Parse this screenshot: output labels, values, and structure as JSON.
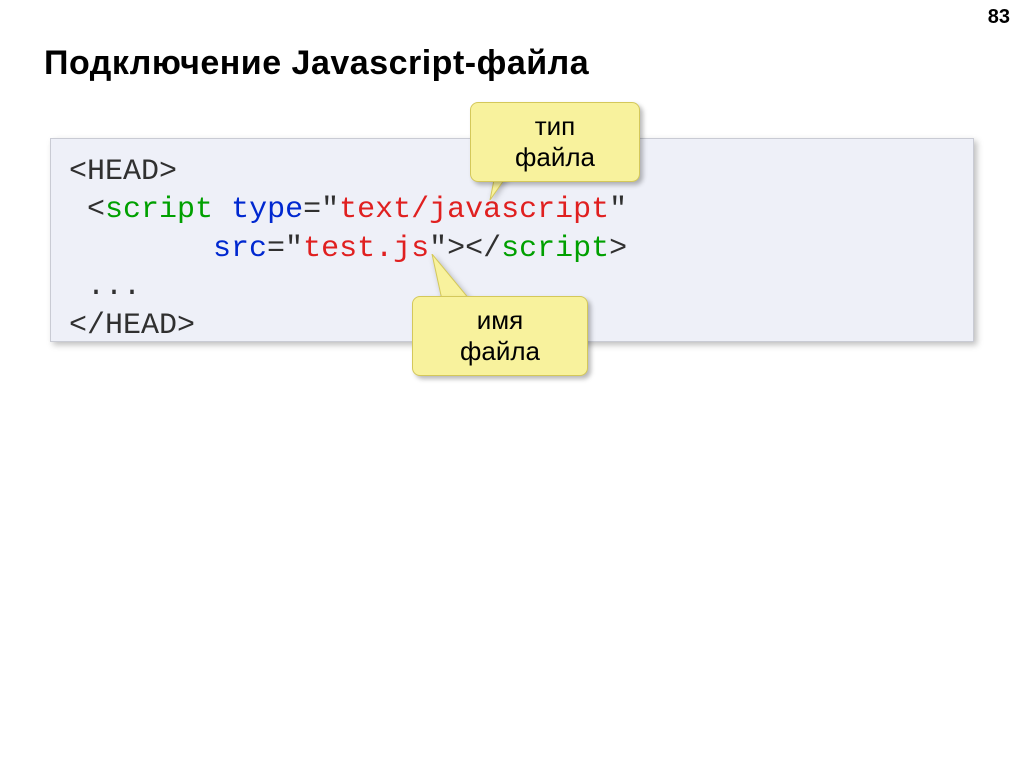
{
  "page_number": "83",
  "title": "Подключение Javascript-файла",
  "callouts": {
    "file_type": "тип файла",
    "file_name": "имя файла"
  },
  "code": {
    "line1_open": "<HEAD>",
    "line2_indent": " <",
    "line2_tag": "script",
    "line2_sp": " ",
    "line2_attr1": "type",
    "line2_eqq": "=\"",
    "line2_val1": "text/javascript",
    "line2_q": "\"",
    "line3_indent": "        ",
    "line3_attr2": "src",
    "line3_eqq": "=\"",
    "line3_val2": "test.js",
    "line3_qgt": "\">",
    "line3_clo": "</",
    "line3_tag": "script",
    "line3_gt": ">",
    "line4": " ...",
    "line5": "</HEAD>"
  }
}
